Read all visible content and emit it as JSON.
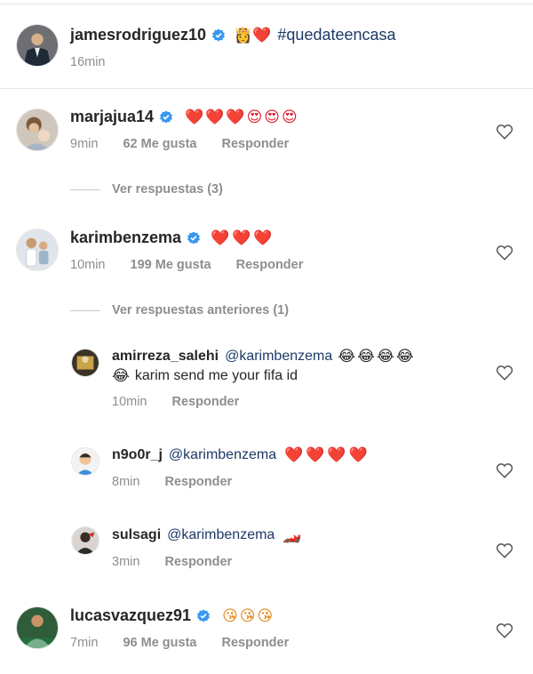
{
  "caption": {
    "username": "jamesrodriguez10",
    "emoji_text": "👸❤️",
    "hashtag": "#quedateencasa",
    "time": "16min"
  },
  "comments": [
    {
      "username": "marjajua14",
      "emoji_text": "❤️❤️❤️😍😍😍",
      "time": "9min",
      "likes": "62 Me gusta",
      "reply": "Responder",
      "view_replies": "Ver respuestas (3)"
    },
    {
      "username": "karimbenzema",
      "emoji_text": "❤️❤️❤️",
      "time": "10min",
      "likes": "199 Me gusta",
      "reply": "Responder",
      "view_replies": "Ver respuestas anteriores (1)"
    },
    {
      "username": "lucasvazquez91",
      "emoji_text": "😘😘😘",
      "time": "7min",
      "likes": "96 Me gusta",
      "reply": "Responder"
    }
  ],
  "replies": [
    {
      "username": "amirreza_salehi",
      "mention": "@karimbenzema",
      "emoji_text": "😂😂😂😂",
      "line2_emoji": "😂",
      "line2_text": "karim send me your fifa id",
      "time": "10min",
      "reply": "Responder"
    },
    {
      "username": "n9o0r_j",
      "mention": "@karimbenzema",
      "emoji_text": "❤️❤️❤️❤️",
      "time": "8min",
      "reply": "Responder"
    },
    {
      "username": "sulsagi",
      "mention": "@karimbenzema",
      "emoji_text": "🏎️",
      "time": "3min",
      "reply": "Responder"
    }
  ],
  "colors": {
    "verified": "#3897f0",
    "secondary_text": "#8e8e8e",
    "mention": "#1c3a66",
    "heart": "#e0182d"
  },
  "icons": [
    "verified-badge-icon",
    "heart-outline-icon"
  ]
}
